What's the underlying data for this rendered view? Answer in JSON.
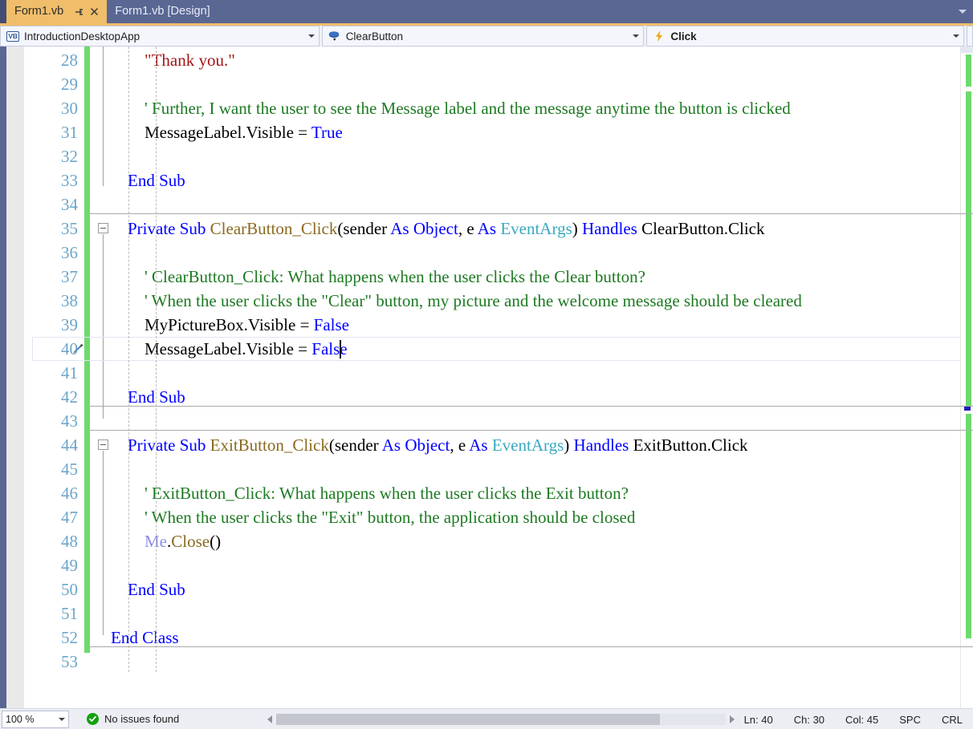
{
  "tabs": [
    {
      "label": "Form1.vb",
      "active": true,
      "pin_icon": "pin-icon",
      "close_icon": "close-icon"
    },
    {
      "label": "Form1.vb [Design]",
      "active": false
    }
  ],
  "tabstrip": {
    "menu_icon": "chevron-down-icon"
  },
  "navbar": {
    "project": {
      "icon": "vb-project-icon",
      "badge": "VB",
      "value": "IntroductionDesktopApp",
      "arrow": "chevron-down-icon"
    },
    "object": {
      "icon": "object-members-icon",
      "value": "ClearButton",
      "arrow": "chevron-down-icon"
    },
    "member": {
      "icon": "event-lightning-icon",
      "value": "Click",
      "arrow": "chevron-down-icon"
    }
  },
  "editor": {
    "first_line_number": 28,
    "lines": [
      {
        "n": 28,
        "indent": 0,
        "tokens": [
          {
            "t": "        ",
            "c": "plain"
          },
          {
            "t": "\"Thank you.\"",
            "c": "str"
          }
        ]
      },
      {
        "n": 29,
        "indent": 0,
        "tokens": []
      },
      {
        "n": 30,
        "indent": 0,
        "tokens": [
          {
            "t": "        ",
            "c": "plain"
          },
          {
            "t": "' Further, I want the user to see the Message label and the message anytime the button is clicked",
            "c": "cmt"
          }
        ]
      },
      {
        "n": 31,
        "indent": 0,
        "tokens": [
          {
            "t": "        ",
            "c": "plain"
          },
          {
            "t": "MessageLabel.Visible = ",
            "c": "plain"
          },
          {
            "t": "True",
            "c": "kw"
          }
        ]
      },
      {
        "n": 32,
        "indent": 0,
        "tokens": []
      },
      {
        "n": 33,
        "indent": 0,
        "tokens": [
          {
            "t": "    ",
            "c": "plain"
          },
          {
            "t": "End Sub",
            "c": "kw"
          }
        ]
      },
      {
        "n": 34,
        "indent": 0,
        "tokens": []
      },
      {
        "n": 35,
        "indent": 0,
        "tokens": [
          {
            "t": "    ",
            "c": "plain"
          },
          {
            "t": "Private Sub ",
            "c": "kw"
          },
          {
            "t": "ClearButton_Click",
            "c": "meth"
          },
          {
            "t": "(sender ",
            "c": "plain"
          },
          {
            "t": "As ",
            "c": "kw"
          },
          {
            "t": "Object",
            "c": "kw"
          },
          {
            "t": ", e ",
            "c": "plain"
          },
          {
            "t": "As ",
            "c": "kw"
          },
          {
            "t": "EventArgs",
            "c": "typ"
          },
          {
            "t": ") ",
            "c": "plain"
          },
          {
            "t": "Handles ",
            "c": "kw"
          },
          {
            "t": "ClearButton.Click",
            "c": "plain"
          }
        ]
      },
      {
        "n": 36,
        "indent": 0,
        "tokens": []
      },
      {
        "n": 37,
        "indent": 0,
        "tokens": [
          {
            "t": "        ",
            "c": "plain"
          },
          {
            "t": "' ClearButton_Click: What happens when the user clicks the Clear button?",
            "c": "cmt"
          }
        ]
      },
      {
        "n": 38,
        "indent": 0,
        "tokens": [
          {
            "t": "        ",
            "c": "plain"
          },
          {
            "t": "' When the user clicks the \"Clear\" button, my picture and the welcome message should be cleared",
            "c": "cmt"
          }
        ]
      },
      {
        "n": 39,
        "indent": 0,
        "tokens": [
          {
            "t": "        ",
            "c": "plain"
          },
          {
            "t": "MyPictureBox.Visible = ",
            "c": "plain"
          },
          {
            "t": "False",
            "c": "kw"
          }
        ]
      },
      {
        "n": 40,
        "indent": 0,
        "current": true,
        "tokens": [
          {
            "t": "        ",
            "c": "plain"
          },
          {
            "t": "MessageLabel.Visible = ",
            "c": "plain"
          },
          {
            "t": "False",
            "c": "kw"
          }
        ]
      },
      {
        "n": 41,
        "indent": 0,
        "tokens": []
      },
      {
        "n": 42,
        "indent": 0,
        "tokens": [
          {
            "t": "    ",
            "c": "plain"
          },
          {
            "t": "End Sub",
            "c": "kw"
          }
        ]
      },
      {
        "n": 43,
        "indent": 0,
        "tokens": []
      },
      {
        "n": 44,
        "indent": 0,
        "tokens": [
          {
            "t": "    ",
            "c": "plain"
          },
          {
            "t": "Private Sub ",
            "c": "kw"
          },
          {
            "t": "ExitButton_Click",
            "c": "meth"
          },
          {
            "t": "(sender ",
            "c": "plain"
          },
          {
            "t": "As ",
            "c": "kw"
          },
          {
            "t": "Object",
            "c": "kw"
          },
          {
            "t": ", e ",
            "c": "plain"
          },
          {
            "t": "As ",
            "c": "kw"
          },
          {
            "t": "EventArgs",
            "c": "typ"
          },
          {
            "t": ") ",
            "c": "plain"
          },
          {
            "t": "Handles ",
            "c": "kw"
          },
          {
            "t": "ExitButton.Click",
            "c": "plain"
          }
        ]
      },
      {
        "n": 45,
        "indent": 0,
        "tokens": []
      },
      {
        "n": 46,
        "indent": 0,
        "tokens": [
          {
            "t": "        ",
            "c": "plain"
          },
          {
            "t": "' ExitButton_Click: What happens when the user clicks the Exit button?",
            "c": "cmt"
          }
        ]
      },
      {
        "n": 47,
        "indent": 0,
        "tokens": [
          {
            "t": "        ",
            "c": "plain"
          },
          {
            "t": "' When the user clicks the \"Exit\" button, the application should be closed",
            "c": "cmt"
          }
        ]
      },
      {
        "n": 48,
        "indent": 0,
        "tokens": [
          {
            "t": "        ",
            "c": "plain"
          },
          {
            "t": "Me",
            "c": "me"
          },
          {
            "t": ".",
            "c": "plain"
          },
          {
            "t": "Close",
            "c": "meth"
          },
          {
            "t": "()",
            "c": "plain"
          }
        ]
      },
      {
        "n": 49,
        "indent": 0,
        "tokens": []
      },
      {
        "n": 50,
        "indent": 0,
        "tokens": [
          {
            "t": "    ",
            "c": "plain"
          },
          {
            "t": "End Sub",
            "c": "kw"
          }
        ]
      },
      {
        "n": 51,
        "indent": 0,
        "tokens": []
      },
      {
        "n": 52,
        "indent": 0,
        "tokens": [
          {
            "t": "End Class",
            "c": "kw"
          }
        ]
      },
      {
        "n": 53,
        "indent": 0,
        "tokens": []
      }
    ],
    "quick_action_icon": "screwdriver-quick-actions-icon",
    "outlining": [
      {
        "icon": "collapse-minus-icon",
        "line": 35
      },
      {
        "icon": "collapse-minus-icon",
        "line": 44
      }
    ],
    "colors": {
      "keyword": "#0000ff",
      "comment": "#1d7a22",
      "string": "#a31515",
      "type": "#3aa8c1",
      "method": "#8a6a20",
      "me_keyword": "#8c8ce8",
      "line_number": "#6ca5c9",
      "change_bar": "#6ed96e",
      "tab_active": "#f0bd6a",
      "tab_bar": "#5a6793"
    }
  },
  "statusbar": {
    "zoom": {
      "value": "100 %",
      "arrow": "chevron-down-icon"
    },
    "issues": {
      "icon": "check-circle-icon",
      "label": "No issues found"
    },
    "scroll_left_icon": "triangle-left-icon",
    "scroll_right_icon": "triangle-right-icon",
    "indicators": [
      {
        "name": "line",
        "label": "Ln: 40"
      },
      {
        "name": "char",
        "label": "Ch: 30"
      },
      {
        "name": "column",
        "label": "Col: 45"
      },
      {
        "name": "spaces",
        "label": "SPC"
      },
      {
        "name": "line-endings",
        "label": "CRL"
      }
    ]
  }
}
